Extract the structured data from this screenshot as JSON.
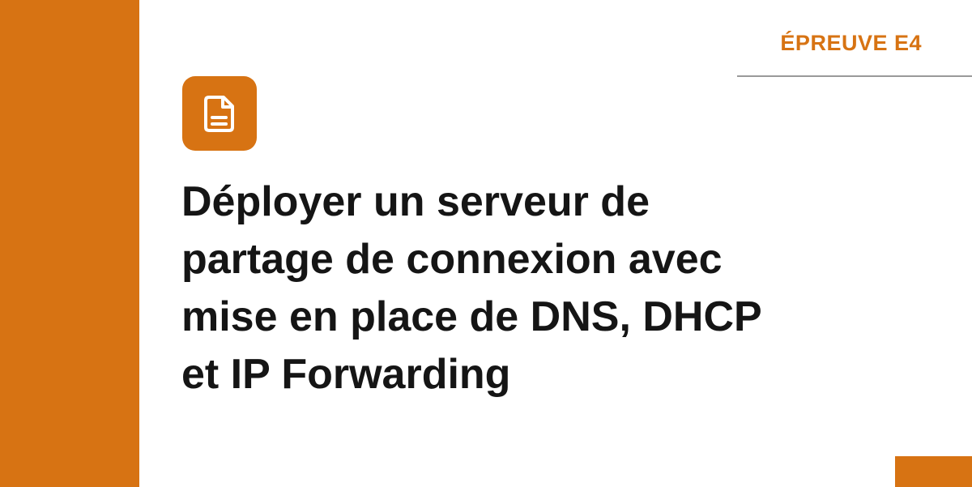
{
  "badge": {
    "label": "ÉPREUVE E4"
  },
  "icon": {
    "name": "document-icon"
  },
  "title": {
    "lines": [
      "Déployer un serveur de",
      "partage de connexion avec",
      "mise en place de DNS, DHCP",
      "et IP Forwarding"
    ]
  },
  "colors": {
    "accent": "#d77313",
    "text": "#151515",
    "rule": "#9a9a9a",
    "background": "#ffffff"
  }
}
